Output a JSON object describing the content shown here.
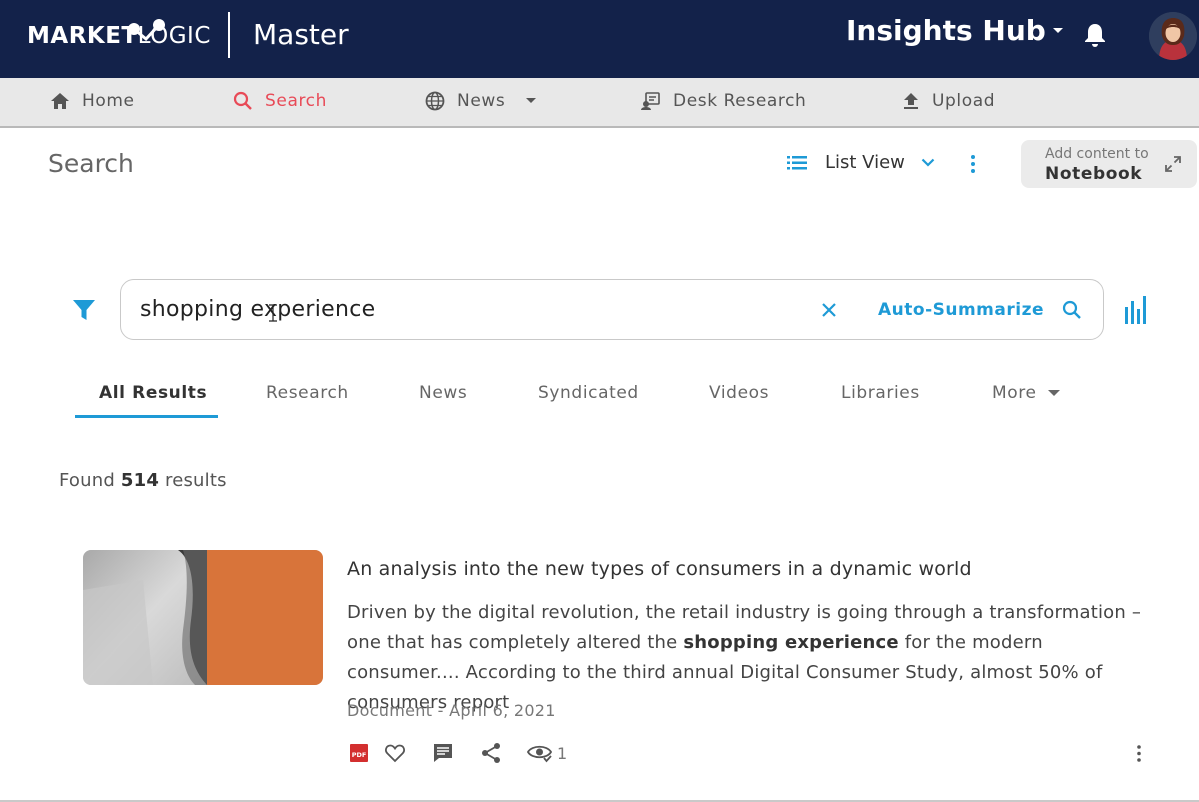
{
  "brand": {
    "logo_part1": "MARKET",
    "logo_part2": "LOGIC",
    "workspace": "Master"
  },
  "header": {
    "hub_label": "Insights Hub"
  },
  "nav": {
    "items": [
      {
        "label": "Home",
        "icon": "home-icon"
      },
      {
        "label": "Search",
        "icon": "search-icon",
        "active": true
      },
      {
        "label": "News",
        "icon": "globe-icon"
      },
      {
        "label": "Desk Research",
        "icon": "desk-research-icon"
      },
      {
        "label": "Upload",
        "icon": "upload-icon"
      }
    ]
  },
  "page": {
    "title": "Search",
    "view_label": "List View",
    "notebook_small": "Add content to",
    "notebook_big": "Notebook"
  },
  "search": {
    "query": "shopping experience",
    "auto_summarize": "Auto-Summarize"
  },
  "tabs": [
    "All Results",
    "Research",
    "News",
    "Syndicated",
    "Videos",
    "Libraries",
    "More"
  ],
  "results": {
    "found_prefix": "Found",
    "count": "514",
    "found_suffix": "results",
    "items": [
      {
        "title": "An analysis into the new types of consumers in a dynamic world",
        "snippet_1": "Driven by the digital revolution, the retail industry is going through a transformation – one that has completely altered the",
        "snippet_bold": "shopping experience",
        "snippet_2": "for the modern consumer.... According to the third annual Digital Consumer Study, almost 50% of consumers report",
        "meta": "Document - April 6, 2021",
        "file_type": "PDF",
        "views": "1"
      }
    ]
  },
  "colors": {
    "topbar": "#13224a",
    "accent": "#1e9ad6",
    "active_nav": "#e84a57",
    "thumb_orange": "#d8743a"
  }
}
